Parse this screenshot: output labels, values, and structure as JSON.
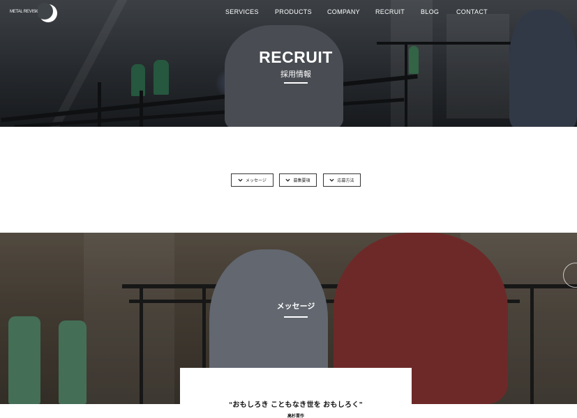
{
  "header": {
    "logo_text": "METAL REVISION",
    "nav": [
      "SERVICES",
      "PRODUCTS",
      "COMPANY",
      "RECRUIT",
      "BLOG",
      "CONTACT"
    ]
  },
  "hero": {
    "title": "RECRUIT",
    "subtitle": "採用情報"
  },
  "anchors": [
    {
      "label": "メッセージ",
      "icon": "chevron-down-icon"
    },
    {
      "label": "募集要項",
      "icon": "chevron-down-icon"
    },
    {
      "label": "応募方法",
      "icon": "chevron-down-icon"
    }
  ],
  "message": {
    "title": "メッセージ",
    "quote": "“おもしろき こともなき世を おもしろく”",
    "author": "高杉晋作",
    "side_icon": "arrow-icon"
  },
  "colors": {
    "text": "#222222",
    "white": "#ffffff"
  }
}
